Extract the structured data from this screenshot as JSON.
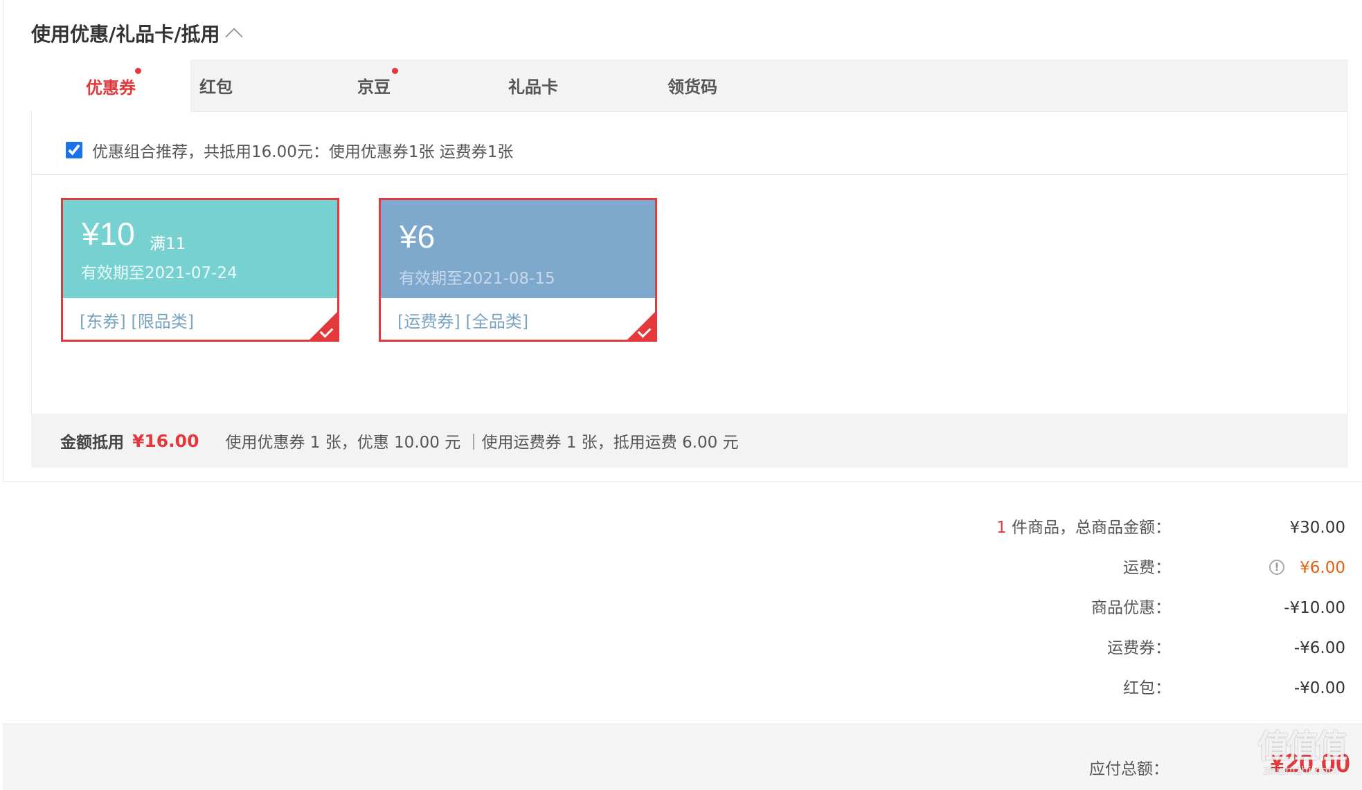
{
  "section": {
    "title": "使用优惠/礼品卡/抵用"
  },
  "tabs": [
    {
      "label": "优惠券",
      "active": true,
      "dot": true
    },
    {
      "label": "红包",
      "active": false,
      "dot": false
    },
    {
      "label": "京豆",
      "active": false,
      "dot": true
    },
    {
      "label": "礼品卡",
      "active": false,
      "dot": false
    },
    {
      "label": "领货码",
      "active": false,
      "dot": false
    }
  ],
  "combo": {
    "checked": true,
    "text": "优惠组合推荐，共抵用16.00元：使用优惠券1张 运费券1张"
  },
  "coupons": [
    {
      "amount": "¥10",
      "condition": "满11",
      "expiry": "有效期至2021-07-24",
      "tags": "[东券]  [限品类]",
      "color": "#77d1d1",
      "expiry_color": "#e9fbfb",
      "selected": true
    },
    {
      "amount": "¥6",
      "condition": "",
      "expiry": "有效期至2021-08-15",
      "tags": "[运费券]  [全品类]",
      "color": "#7fa8cd",
      "expiry_color": "#c7d8ea",
      "selected": true
    }
  ],
  "summary": {
    "label": "金额抵用",
    "amount": "¥16.00",
    "detail": "使用优惠券 1 张，优惠 10.00 元 ｜使用运费券 1 张，抵用运费 6.00 元"
  },
  "prices": {
    "items_count": "1",
    "items_label": " 件商品，总商品金额：",
    "items_value": "¥30.00",
    "shipping_label": "运费：",
    "shipping_value": "¥6.00",
    "discount_label": "商品优惠：",
    "discount_value": "-¥10.00",
    "shipping_coupon_label": "运费券：",
    "shipping_coupon_value": "-¥6.00",
    "redpacket_label": "红包：",
    "redpacket_value": "-¥0.00"
  },
  "total": {
    "label": "应付总额：",
    "value": "¥20.00"
  },
  "watermark": {
    "big": "值值值",
    "small": "zhizhizhi.com"
  },
  "colors": {
    "accent": "#e4393c",
    "shipping": "#e4600f"
  }
}
